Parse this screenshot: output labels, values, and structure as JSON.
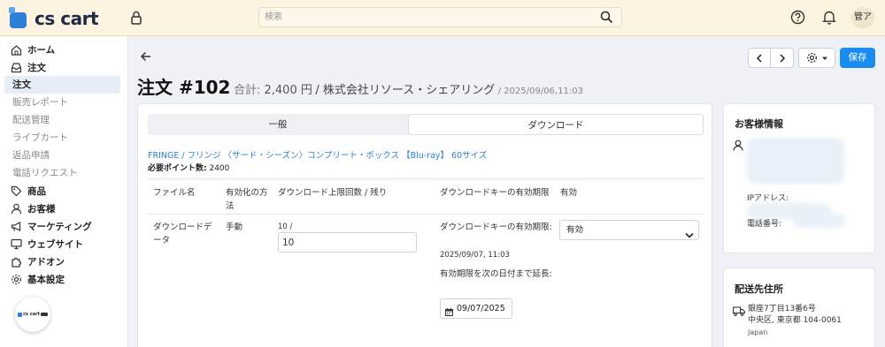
{
  "header": {
    "logo_text": "cs cart",
    "search_placeholder": "検索",
    "avatar": "管ア"
  },
  "sidebar": {
    "items": [
      {
        "label": "ホーム",
        "icon": "home-icon"
      },
      {
        "label": "注文",
        "icon": "inbox-icon"
      },
      {
        "label": "注文",
        "sub": true,
        "active": true
      },
      {
        "label": "販売レポート",
        "sub": true
      },
      {
        "label": "配送管理",
        "sub": true
      },
      {
        "label": "ライブカート",
        "sub": true
      },
      {
        "label": "返品申請",
        "sub": true
      },
      {
        "label": "電話リクエスト",
        "sub": true
      },
      {
        "label": "商品",
        "icon": "tag-icon"
      },
      {
        "label": "お客様",
        "icon": "user-icon"
      },
      {
        "label": "マーケティング",
        "icon": "megaphone-icon"
      },
      {
        "label": "ウェブサイト",
        "icon": "monitor-icon"
      },
      {
        "label": "アドオン",
        "icon": "puzzle-icon"
      },
      {
        "label": "基本設定",
        "icon": "gear-icon"
      }
    ],
    "badge_text": "cs cart"
  },
  "page": {
    "title": "注文 #102",
    "total_label": "合計:",
    "total_value": "2,400 円",
    "company": "/ 株式会社リソース・シェアリング",
    "date": "/ 2025/09/06,11:03",
    "save_label": "保存"
  },
  "tabs": {
    "general": "一般",
    "download": "ダウンロード"
  },
  "product": {
    "link": "FRINGE / フリンジ 〈サード・シーズン〉コンプリート・ボックス 【Blu-ray】 60サイズ",
    "points_label": "必要ポイント数:",
    "points_value": "2400"
  },
  "table": {
    "headers": {
      "filename": "ファイル名",
      "activation": "有効化の方法",
      "max_downloads": "ダウンロード上限回数 / 残り",
      "key_expiry": "ダウンロードキーの有効期限",
      "active": "有効"
    },
    "row": {
      "filename": "ダウンロードデータ",
      "activation": "手動",
      "remaining": "10 /",
      "max_value": "10",
      "expiry_label": "ダウンロードキーの有効期限:",
      "expiry_value": "2025/09/07, 11:03",
      "extend_label": "有効期限を次の日付まで延長:",
      "extend_date": "09/07/2025",
      "status": "有効"
    }
  },
  "customer": {
    "title": "お客様情報",
    "ip_label": "IPアドレス:",
    "phone_label": "電話番号:"
  },
  "shipping": {
    "title": "配送先住所",
    "line1": "銀座7丁目13番6号",
    "line2": "中央区, 東京都 104-0061",
    "country": "Japan"
  }
}
